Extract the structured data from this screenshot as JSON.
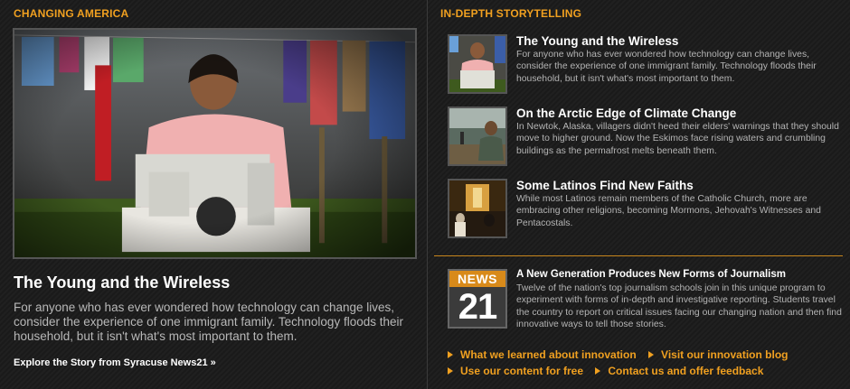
{
  "left": {
    "section_title": "CHANGING AMERICA",
    "hero_title": "The Young and the Wireless",
    "hero_desc": "For anyone who has ever wondered how technology can change lives, consider the experience of one immigrant family. Technology floods their household, but it isn't what's most important to them.",
    "hero_link": "Explore the Story from Syracuse News21 »"
  },
  "right": {
    "section_title": "IN-DEPTH STORYTELLING",
    "stories": [
      {
        "title": "The Young and the Wireless",
        "desc": "For anyone who has ever wondered how technology can change lives, consider the experience of one immigrant family. Technology floods their household, but it isn't what's most important to them."
      },
      {
        "title": "On the Arctic Edge of Climate Change",
        "desc": "In Newtok, Alaska, villagers didn't heed their elders' warnings that they should move to higher ground. Now the Eskimos face rising waters and crumbling buildings as the permafrost melts beneath them."
      },
      {
        "title": "Some Latinos Find New Faiths",
        "desc": "While most Latinos remain members of the Catholic Church, more are embracing other religions, becoming Mormons, Jehovah's Witnesses and Pentacostals."
      }
    ],
    "news21": {
      "logo_top": "NEWS",
      "logo_num": "21",
      "title": "A New Generation Produces New Forms of Journalism",
      "desc": "Twelve of the nation's top journalism schools join in this unique program to experiment with forms of in-depth and investigative reporting. Students travel the country to report on critical issues facing our changing nation and then find innovative ways to tell those stories."
    },
    "links": [
      "What we learned about innovation",
      "Visit our innovation blog",
      "Use our content for free",
      "Contact us and offer feedback"
    ]
  },
  "colors": {
    "accent": "#f0a020",
    "background": "#1c1c1c"
  }
}
